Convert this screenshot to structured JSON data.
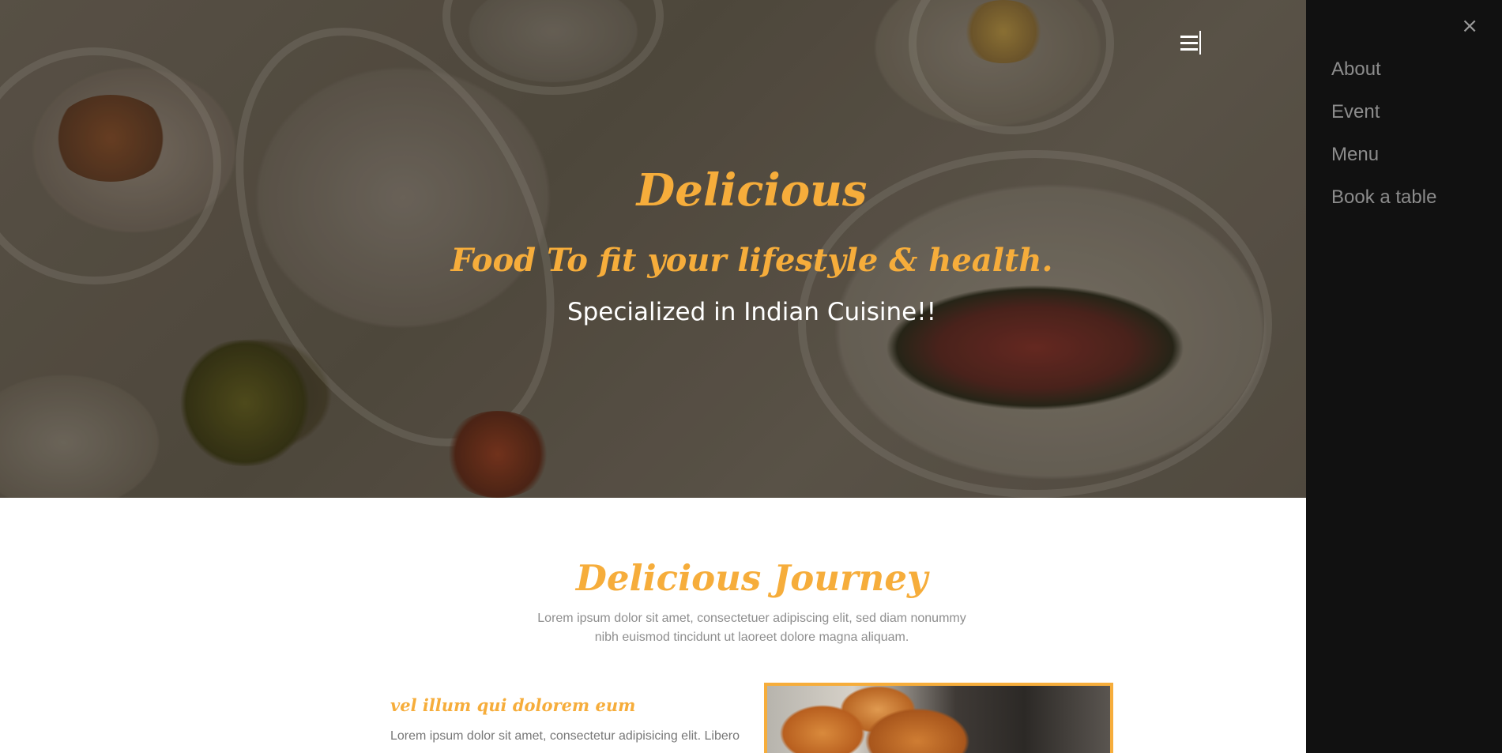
{
  "hero": {
    "title": "Delicious",
    "tagline": "Food To fit your lifestyle & health.",
    "subtitle": "Specialized in Indian Cuisine!!"
  },
  "header": {
    "menu_icon": "hamburger-icon"
  },
  "sidenav": {
    "close_label": "×",
    "close_icon": "close-icon",
    "items": [
      {
        "label": "About"
      },
      {
        "label": "Event"
      },
      {
        "label": "Menu"
      },
      {
        "label": "Book a table"
      }
    ]
  },
  "journey": {
    "title": "Delicious Journey",
    "description": "Lorem ipsum dolor sit amet, consectetuer adipiscing elit, sed diam nonummy nibh euismod tincidunt ut laoreet dolore magna aliquam."
  },
  "article": {
    "title": "vel illum qui dolorem eum",
    "body": "Lorem ipsum dolor sit amet, consectetur adipisicing elit. Libero"
  },
  "colors": {
    "accent": "#f6ad3b",
    "sidenav_bg": "#111111",
    "nav_text": "#8c8c8c"
  }
}
